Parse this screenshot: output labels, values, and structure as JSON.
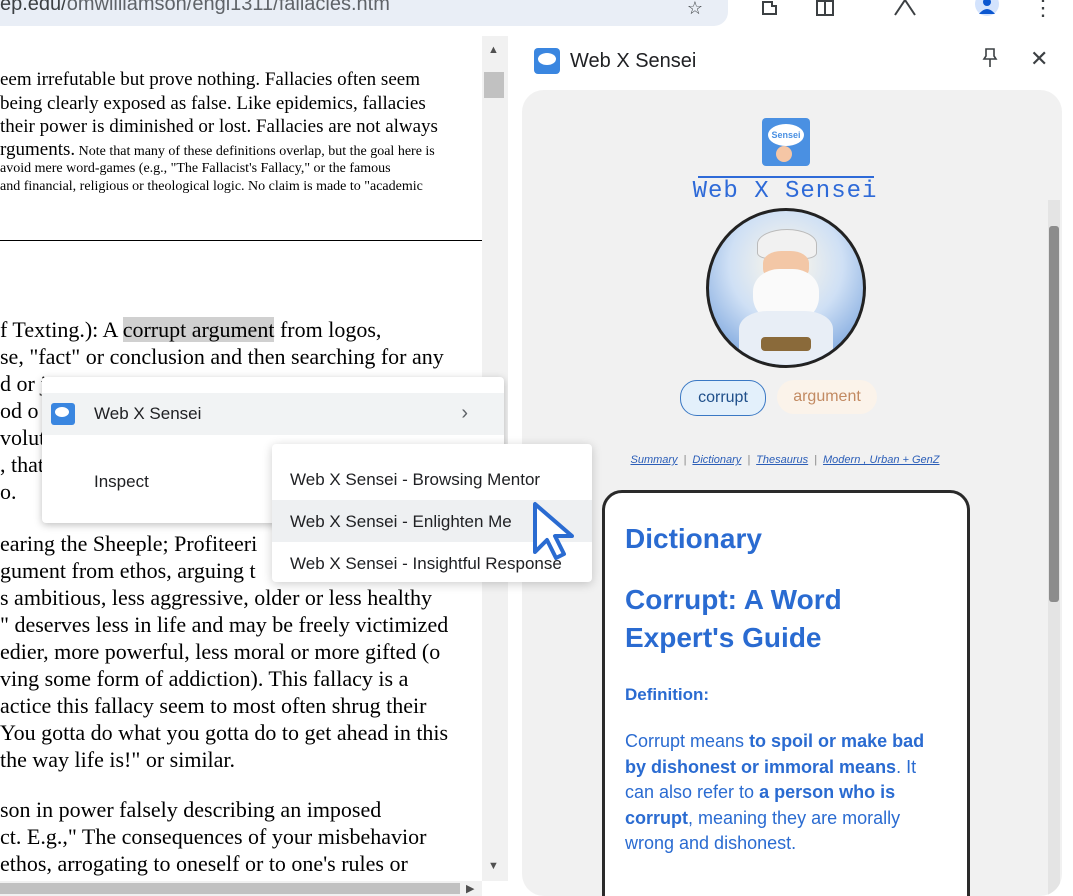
{
  "browser": {
    "url_domain": "ep.edu/",
    "url_path": "omwilliamson/engl1311/fallacies.htm"
  },
  "page": {
    "intro_lines": [
      "eem irrefutable but prove nothing. Fallacies often seem",
      "being clearly exposed as false. Like epidemics, fallacies",
      " their power is diminished or lost. Fallacies are not always"
    ],
    "intro_line4_big": "rguments.",
    "intro_line4_small": " Note that many of these definitions overlap, but the goal here is",
    "small_lines": [
      "avoid mere word-games (e.g., \"The Fallacist's Fallacy,\" or the famous",
      "and financial, religious or theological logic.  No claim is made to \"academic"
    ],
    "texting_pre": "f Texting.): A ",
    "highlight": "corrupt argument",
    "texting_post": " from logos,",
    "body_lines": [
      "se, \"fact\" or conclusion and then searching for any",
      "d or j",
      "od o",
      "volut",
      ", that",
      "o."
    ],
    "body_lines2": [
      "earing the Sheeple; Profiteeri",
      "gument from ethos, arguing t",
      "s ambitious, less aggressive, older or less healthy",
      "\" deserves less in life and may be freely victimized",
      "edier, more powerful, less moral or more gifted (o",
      "ving some form of addiction). This fallacy is a",
      "actice this fallacy seem to most often shrug their",
      "You gotta do what you gotta do to get ahead in this",
      " the way life is!\" or similar."
    ],
    "body_lines3": [
      "son in power falsely describing an imposed",
      "ct. E.g.,\" The consequences of your misbehavior",
      "ethos, arrogating to oneself or to one's rules or"
    ]
  },
  "context_menu": {
    "item1": "Web X Sensei",
    "item2": "Inspect",
    "submenu": [
      "Web X Sensei - Browsing Mentor",
      "Web X Sensei - Enlighten Me",
      "Web X Sensei - Insightful Response"
    ]
  },
  "panel": {
    "title": "Web X Sensei",
    "brand": "Web X Sensei",
    "logo_text": "Sensei",
    "chips": [
      "corrupt",
      "argument"
    ],
    "links": [
      "Summary",
      "Dictionary",
      "Thesaurus",
      "Modern , Urban + GenZ"
    ],
    "card": {
      "heading": "Dictionary",
      "title": "Corrupt: A Word Expert's Guide",
      "def_label": "Definition:",
      "def_p1": "Corrupt means ",
      "def_b1": "to spoil or make bad by dishonest or immoral means",
      "def_p2": ". It can also refer to ",
      "def_b2": "a person who is corrupt",
      "def_p3": ", meaning they are morally wrong and dishonest."
    }
  },
  "colors": {
    "accent": "#2a6bd1",
    "highlight": "#d0d0d0",
    "panel_bg": "#f1f1f1"
  }
}
